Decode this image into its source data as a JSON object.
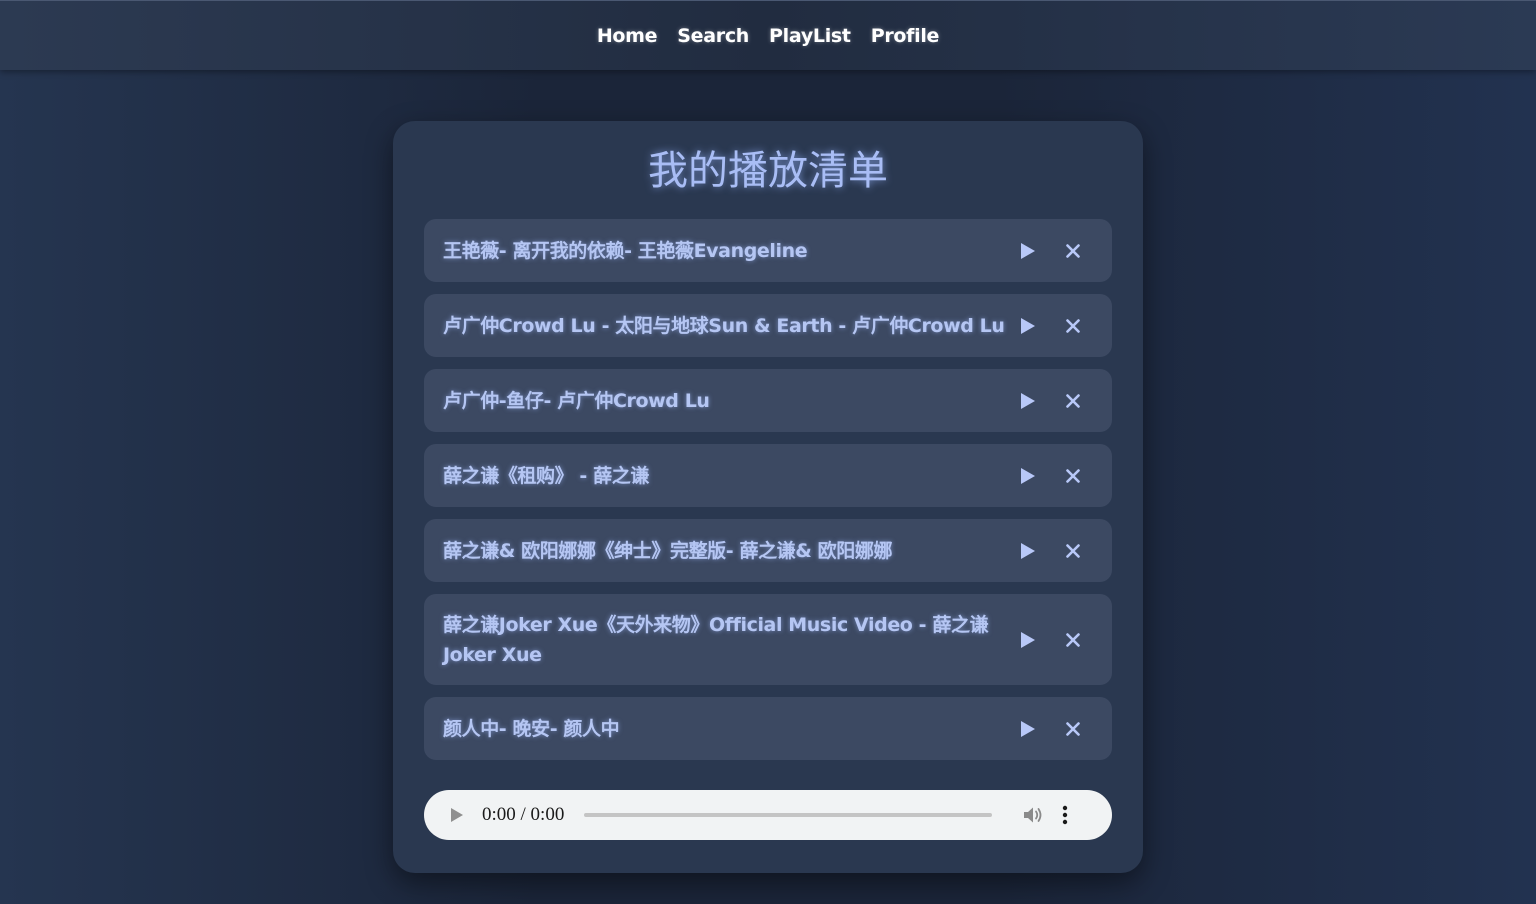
{
  "nav": {
    "links": [
      "Home",
      "Search",
      "PlayList",
      "Profile"
    ]
  },
  "playlist": {
    "title": "我的播放清单",
    "items": [
      {
        "title": "王艳薇- 离开我的依赖- 王艳薇Evangeline"
      },
      {
        "title": "卢广仲Crowd Lu - 太阳与地球Sun & Earth - 卢广仲Crowd Lu"
      },
      {
        "title": "卢广仲-鱼仔- 卢广仲Crowd Lu"
      },
      {
        "title": "薛之谦《租购》 - 薛之谦"
      },
      {
        "title": "薛之谦& 欧阳娜娜《绅士》完整版- 薛之谦& 欧阳娜娜"
      },
      {
        "title": "薛之谦Joker Xue《天外来物》Official Music Video - 薛之谦Joker Xue"
      },
      {
        "title": "颜人中- 晚安- 颜人中"
      }
    ]
  },
  "player": {
    "time": "0:00 / 0:00"
  },
  "colors": {
    "accent": "#a9bdf5",
    "card": "#2a3850",
    "item": "#3c4962"
  },
  "icons": {
    "play": "play-icon",
    "remove": "close-icon",
    "volume": "volume-icon",
    "menu": "more-vertical-icon"
  }
}
